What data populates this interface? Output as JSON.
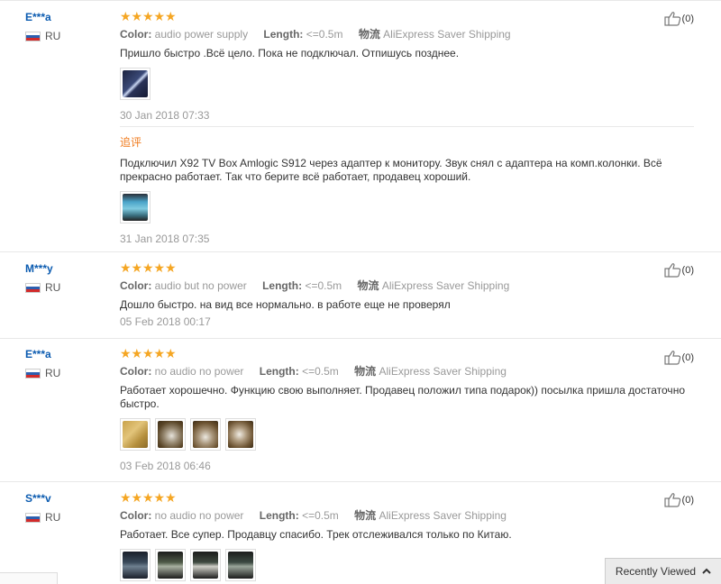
{
  "labels": {
    "color": "Color:",
    "length": "Length:",
    "ship_from": "物流",
    "additional_feedback": "追评"
  },
  "recently_viewed": "Recently Viewed",
  "colors": {
    "star": "#f5a623",
    "username": "#0b5bb0",
    "additional_label": "#f07b1d"
  },
  "reviews": [
    {
      "user": "E***a",
      "country": "RU",
      "stars": 5,
      "color": "audio power supply",
      "length": "<=0.5m",
      "shipping": "AliExpress Saver Shipping",
      "text": "Пришло быстро .Всё цело. Пока не подключал. Отпишусь позднее.",
      "date": "30 Jan 2018 07:33",
      "likes": "(0)",
      "additional": {
        "text": "Подключил X92 TV Box Amlogic S912 через адаптер к монитору. Звук снял с адаптера на комп.колонки. Всё прекрасно работает. Так что берите всё работает, продавец хороший.",
        "date": "31 Jan 2018 07:35"
      }
    },
    {
      "user": "M***y",
      "country": "RU",
      "stars": 5,
      "color": "audio but no power",
      "length": "<=0.5m",
      "shipping": "AliExpress Saver Shipping",
      "text": "Дошло быстро. на вид все нормально. в работе еще не проверял",
      "date": "05 Feb 2018 00:17",
      "likes": "(0)"
    },
    {
      "user": "E***a",
      "country": "RU",
      "stars": 5,
      "color": "no audio no power",
      "length": "<=0.5m",
      "shipping": "AliExpress Saver Shipping",
      "text": "Работает хорошечно. Функцию свою выполняет. Продавец положил типа подарок)) посылка пришла достаточно быстро.",
      "date": "03 Feb 2018 06:46",
      "likes": "(0)"
    },
    {
      "user": "S***v",
      "country": "RU",
      "stars": 5,
      "color": "no audio no power",
      "length": "<=0.5m",
      "shipping": "AliExpress Saver Shipping",
      "text": "Работает. Все супер. Продавцу спасибо. Трек отслеживался только по Китаю.",
      "likes": "(0)"
    }
  ]
}
